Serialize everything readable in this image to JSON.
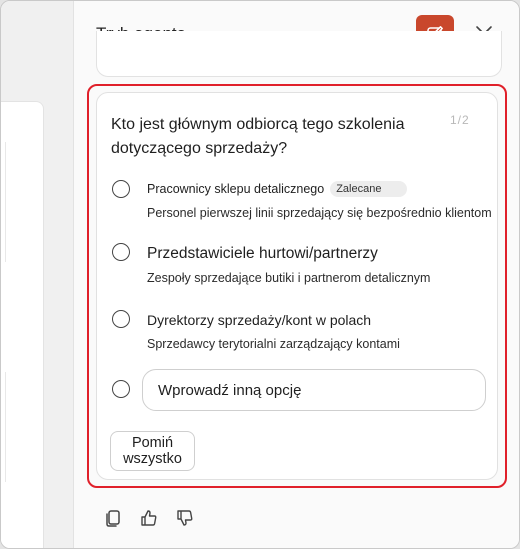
{
  "panel": {
    "title": "Tryb agenta"
  },
  "colors": {
    "accent": "#c9472c",
    "highlight": "#e0202a"
  },
  "icons": {
    "new": "compose-icon",
    "close": "close-icon",
    "copy": "copy-icon",
    "like": "thumbs-up-icon",
    "dislike": "thumbs-down-icon"
  },
  "question": {
    "text": "Kto jest głównym odbiorcą tego szkolenia dotyczącego sprzedaży?",
    "page_indicator": "1/2",
    "options": [
      {
        "title": "Pracownicy sklepu detalicznego",
        "badge": "Zalecane",
        "desc": "Personel pierwszej linii sprzedający się bezpośrednio klientom"
      },
      {
        "title": "Przedstawiciele hurtowi/partnerzy",
        "desc": "Zespoły sprzedające butiki i partnerom detalicznym"
      },
      {
        "title": "Dyrektorzy sprzedaży/kont w polach",
        "desc": "Sprzedawcy terytorialni zarządzający kontami"
      }
    ],
    "other_placeholder": "Wprowadź inną opcję",
    "skip_label": "Pomiń wszystko"
  }
}
